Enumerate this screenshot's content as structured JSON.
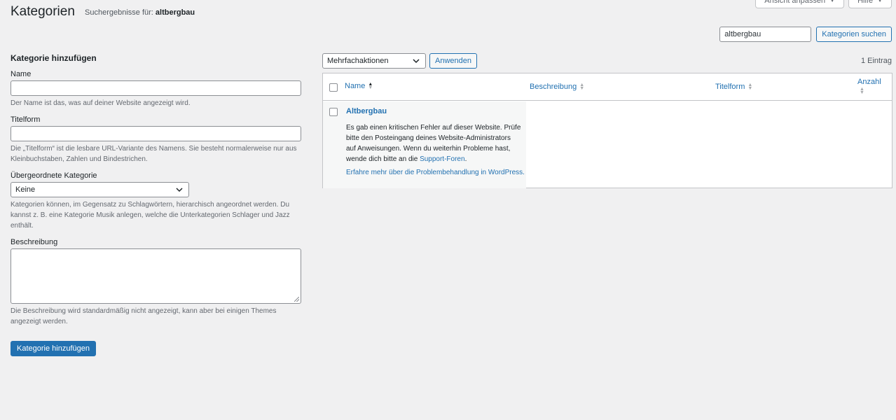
{
  "screen_meta": {
    "options_label": "Ansicht anpassen",
    "help_label": "Hilfe"
  },
  "header": {
    "title": "Kategorien",
    "subtitle_prefix": "Suchergebnisse für: ",
    "subtitle_query": "altbergbau"
  },
  "search": {
    "value": "altbergbau",
    "button_label": "Kategorien suchen"
  },
  "form": {
    "heading": "Kategorie hinzufügen",
    "name_label": "Name",
    "name_help": "Der Name ist das, was auf deiner Website angezeigt wird.",
    "slug_label": "Titelform",
    "slug_help": "Die „Titelform“ ist die lesbare URL-Variante des Namens. Sie besteht normalerweise nur aus Kleinbuchstaben, Zahlen und Bindestrichen.",
    "parent_label": "Übergeordnete Kategorie",
    "parent_selected": "Keine",
    "parent_help": "Kategorien können, im Gegensatz zu Schlagwörtern, hierarchisch angeordnet werden. Du kannst z. B. eine Kategorie Musik anlegen, welche die Unterkategorien Schlager und Jazz enthält.",
    "description_label": "Beschreibung",
    "description_help": "Die Beschreibung wird standardmäßig nicht angezeigt, kann aber bei einigen Themes angezeigt werden.",
    "submit_label": "Kategorie hinzufügen"
  },
  "tablenav": {
    "bulk_selected": "Mehrfachaktionen",
    "apply_label": "Anwenden",
    "count": "1 Eintrag"
  },
  "table": {
    "col_name": "Name",
    "col_description": "Beschreibung",
    "col_slug": "Titelform",
    "col_count": "Anzahl",
    "row": {
      "name": "Altbergbau",
      "error_text": "Es gab einen kritischen Fehler auf dieser Website. Prüfe bitte den Posteingang deines Website-Administrators auf Anweisungen. Wenn du weiterhin Probleme hast, wende dich bitte an die ",
      "error_link": "Support-Foren",
      "error_end": ".",
      "help_link": "Erfahre mehr über die Problembehandlung in WordPress."
    }
  }
}
